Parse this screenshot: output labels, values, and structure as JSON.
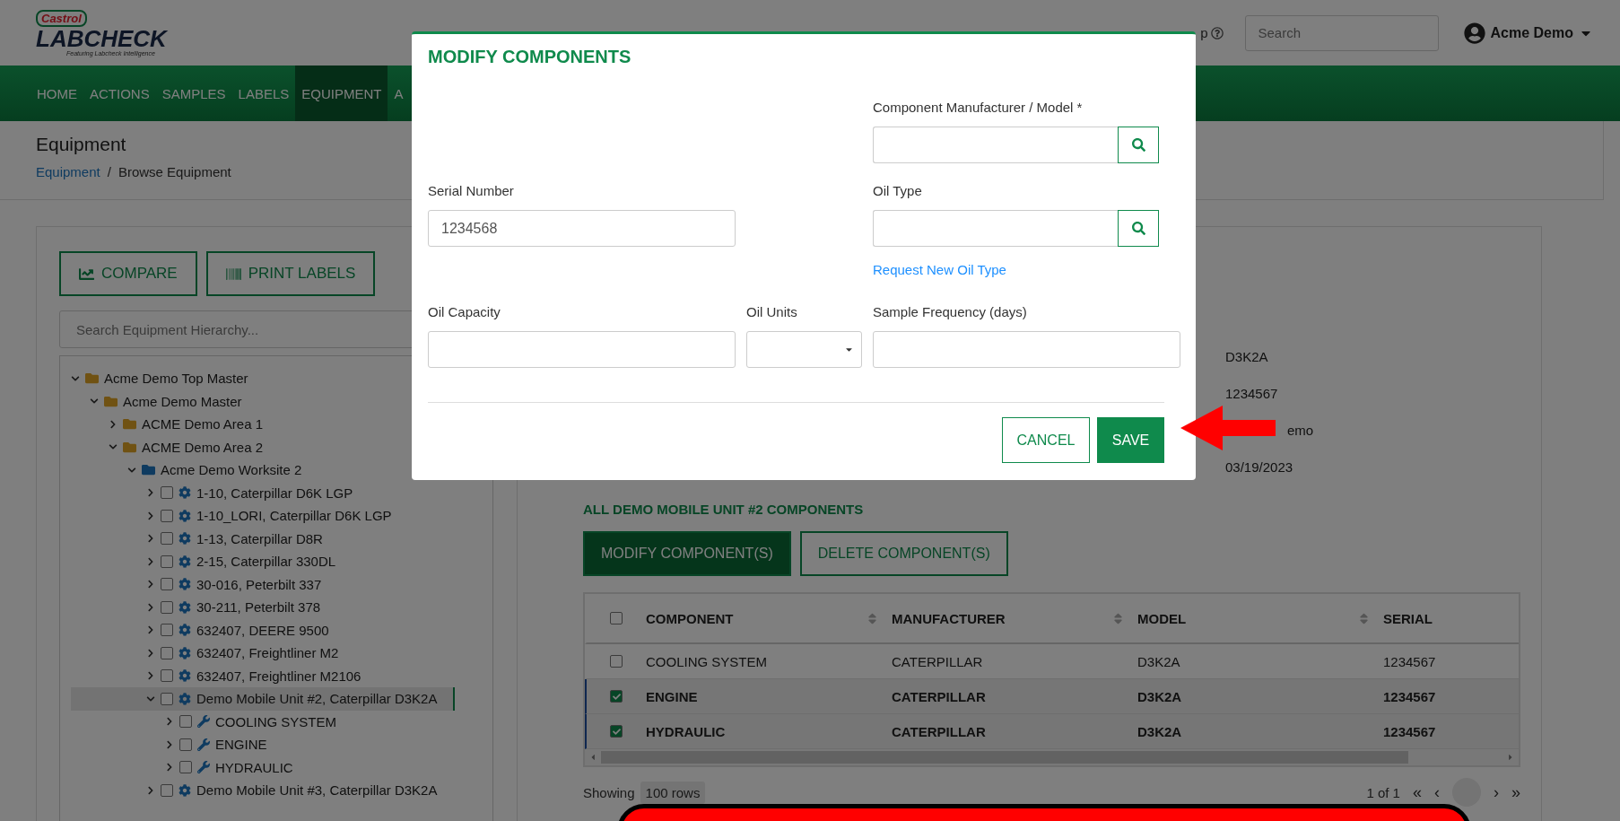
{
  "header": {
    "logo": {
      "brand": "Castrol",
      "product": "LABCHECK",
      "tagline": "Featuring Labcheck Intelligence"
    },
    "help": "p",
    "search": {
      "placeholder": "Search"
    },
    "user": "Acme Demo"
  },
  "nav": [
    {
      "label": "HOME",
      "selected": false
    },
    {
      "label": "ACTIONS",
      "selected": false
    },
    {
      "label": "SAMPLES",
      "selected": false
    },
    {
      "label": "LABELS",
      "selected": false
    },
    {
      "label": "EQUIPMENT",
      "selected": true
    },
    {
      "label": "A",
      "selected": false
    }
  ],
  "page": {
    "title": "Equipment",
    "breadcrumb": [
      {
        "label": "Equipment",
        "link": true
      },
      {
        "label": "/",
        "link": false
      },
      {
        "label": "Browse Equipment",
        "link": false
      }
    ]
  },
  "left": {
    "buttons": [
      {
        "label": "COMPARE",
        "kind": "chart"
      },
      {
        "label": "PRINT LABELS",
        "kind": "barcode"
      }
    ],
    "search": {
      "placeholder": "Search Equipment Hierarchy..."
    },
    "tree": [
      {
        "label": "Acme Demo Top Master",
        "kind": "folder",
        "expanded": true,
        "selected": false,
        "children": [
          {
            "label": "Acme Demo Master",
            "kind": "folder",
            "expanded": true,
            "selected": false,
            "children": [
              {
                "label": "ACME Demo Area 1",
                "kind": "folder",
                "expanded": false,
                "selected": false
              },
              {
                "label": "ACME Demo Area 2",
                "kind": "folder",
                "expanded": true,
                "selected": false,
                "children": [
                  {
                    "label": "Acme Demo Worksite 2",
                    "kind": "site",
                    "expanded": true,
                    "selected": false,
                    "children": [
                      {
                        "label": "1-10, Caterpillar D6K LGP",
                        "kind": "equipment",
                        "expanded": false,
                        "checked": false,
                        "selected": false
                      },
                      {
                        "label": "1-10_LORI, Caterpillar D6K LGP",
                        "kind": "equipment",
                        "expanded": false,
                        "checked": false,
                        "selected": false
                      },
                      {
                        "label": "1-13, Caterpillar D8R",
                        "kind": "equipment",
                        "expanded": false,
                        "checked": false,
                        "selected": false
                      },
                      {
                        "label": "2-15, Caterpillar 330DL",
                        "kind": "equipment",
                        "expanded": false,
                        "checked": false,
                        "selected": false
                      },
                      {
                        "label": "30-016, Peterbilt 337",
                        "kind": "equipment",
                        "expanded": false,
                        "checked": false,
                        "selected": false
                      },
                      {
                        "label": "30-211, Peterbilt 378",
                        "kind": "equipment",
                        "expanded": false,
                        "checked": false,
                        "selected": false
                      },
                      {
                        "label": "632407, DEERE 9500",
                        "kind": "equipment",
                        "expanded": false,
                        "checked": false,
                        "selected": false
                      },
                      {
                        "label": "632407, Freightliner M2",
                        "kind": "equipment",
                        "expanded": false,
                        "checked": false,
                        "selected": false
                      },
                      {
                        "label": "632407, Freightliner M2106",
                        "kind": "equipment",
                        "expanded": false,
                        "checked": false,
                        "selected": false
                      },
                      {
                        "label": "Demo Mobile Unit #2, Caterpillar D3K2A",
                        "kind": "equipment",
                        "expanded": true,
                        "checked": false,
                        "selected": true,
                        "children": [
                          {
                            "label": "COOLING SYSTEM",
                            "kind": "component",
                            "expanded": false,
                            "checked": false,
                            "selected": false
                          },
                          {
                            "label": "ENGINE",
                            "kind": "component",
                            "expanded": false,
                            "checked": false,
                            "selected": false
                          },
                          {
                            "label": "HYDRAULIC",
                            "kind": "component",
                            "expanded": false,
                            "checked": false,
                            "selected": false
                          }
                        ]
                      },
                      {
                        "label": "Demo Mobile Unit #3, Caterpillar D3K2A",
                        "kind": "equipment",
                        "expanded": false,
                        "checked": false,
                        "selected": false
                      }
                    ]
                  }
                ]
              }
            ]
          }
        ]
      }
    ]
  },
  "details": [
    "D3K2A",
    "1234567",
    "emo",
    "03/19/2023"
  ],
  "components": {
    "title": "ALL DEMO MOBILE UNIT #2 COMPONENTS",
    "buttons": [
      {
        "label": "MODIFY COMPONENT(S)",
        "kind": "primary"
      },
      {
        "label": "DELETE COMPONENT(S)",
        "kind": "outline"
      }
    ],
    "columns": [
      "COMPONENT",
      "MANUFACTURER",
      "MODEL",
      "SERIAL"
    ],
    "all_checked": false,
    "rows": [
      {
        "cells": [
          "COOLING SYSTEM",
          "CATERPILLAR",
          "D3K2A",
          "1234567"
        ],
        "checked": false,
        "selected": false
      },
      {
        "cells": [
          "ENGINE",
          "CATERPILLAR",
          "D3K2A",
          "1234567"
        ],
        "checked": true,
        "selected": true
      },
      {
        "cells": [
          "HYDRAULIC",
          "CATERPILLAR",
          "D3K2A",
          "1234567"
        ],
        "checked": true,
        "selected": true
      }
    ],
    "footer": {
      "showing": "Showing",
      "page_size": "100 rows",
      "pages": "1 of 1",
      "first": "«",
      "prev": "‹",
      "next": "›",
      "last": "»"
    }
  },
  "modal": {
    "title": "MODIFY COMPONENTS",
    "manufacturer_label": "Component Manufacturer / Model *",
    "serial_label": "Serial Number",
    "serial_value": "1234568",
    "oil_type_label": "Oil Type",
    "oil_type_link": "Request New Oil Type",
    "capacity_label": "Oil Capacity",
    "units_label": "Oil Units",
    "frequency_label": "Sample Frequency (days)",
    "cancel": "CANCEL",
    "save": "SAVE"
  }
}
